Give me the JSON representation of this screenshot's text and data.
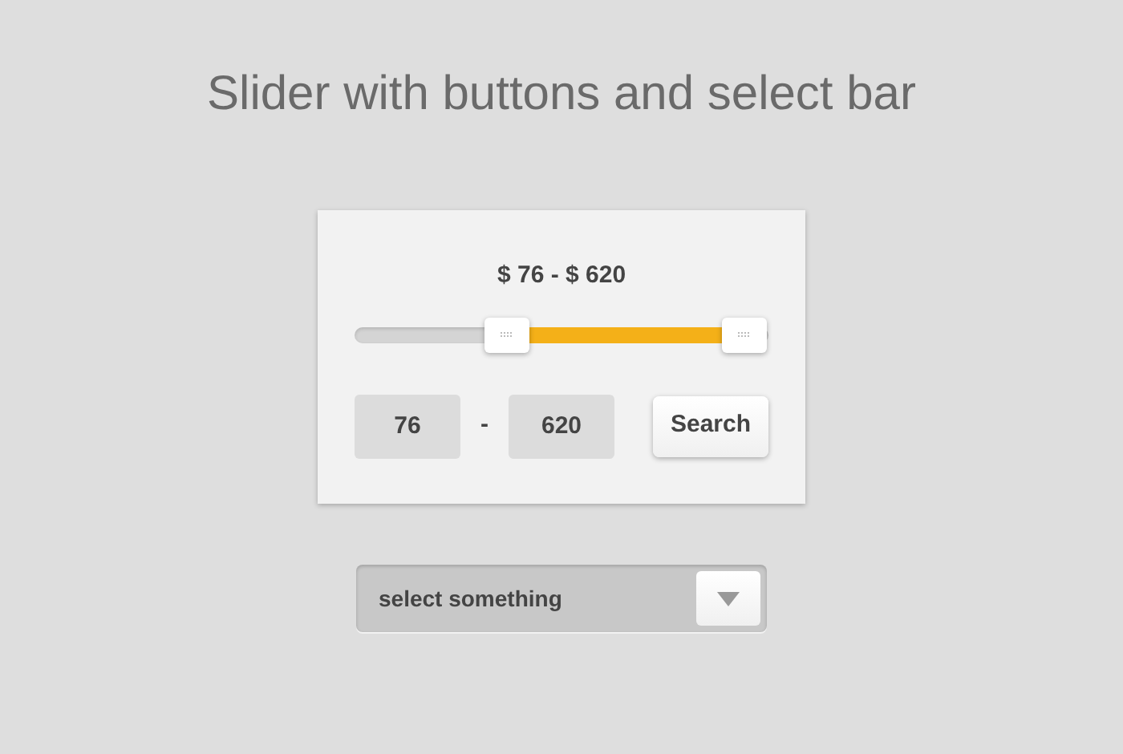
{
  "title": "Slider with buttons and select bar",
  "range_label": "$ 76 - $ 620",
  "slider": {
    "handles": [
      {
        "level": 0.37
      },
      {
        "level": 0.94
      }
    ]
  },
  "min_field": {
    "value": "76"
  },
  "separator": "-",
  "max_field": {
    "value": "620"
  },
  "search_button": "Search",
  "select": {
    "value": "select something"
  }
}
